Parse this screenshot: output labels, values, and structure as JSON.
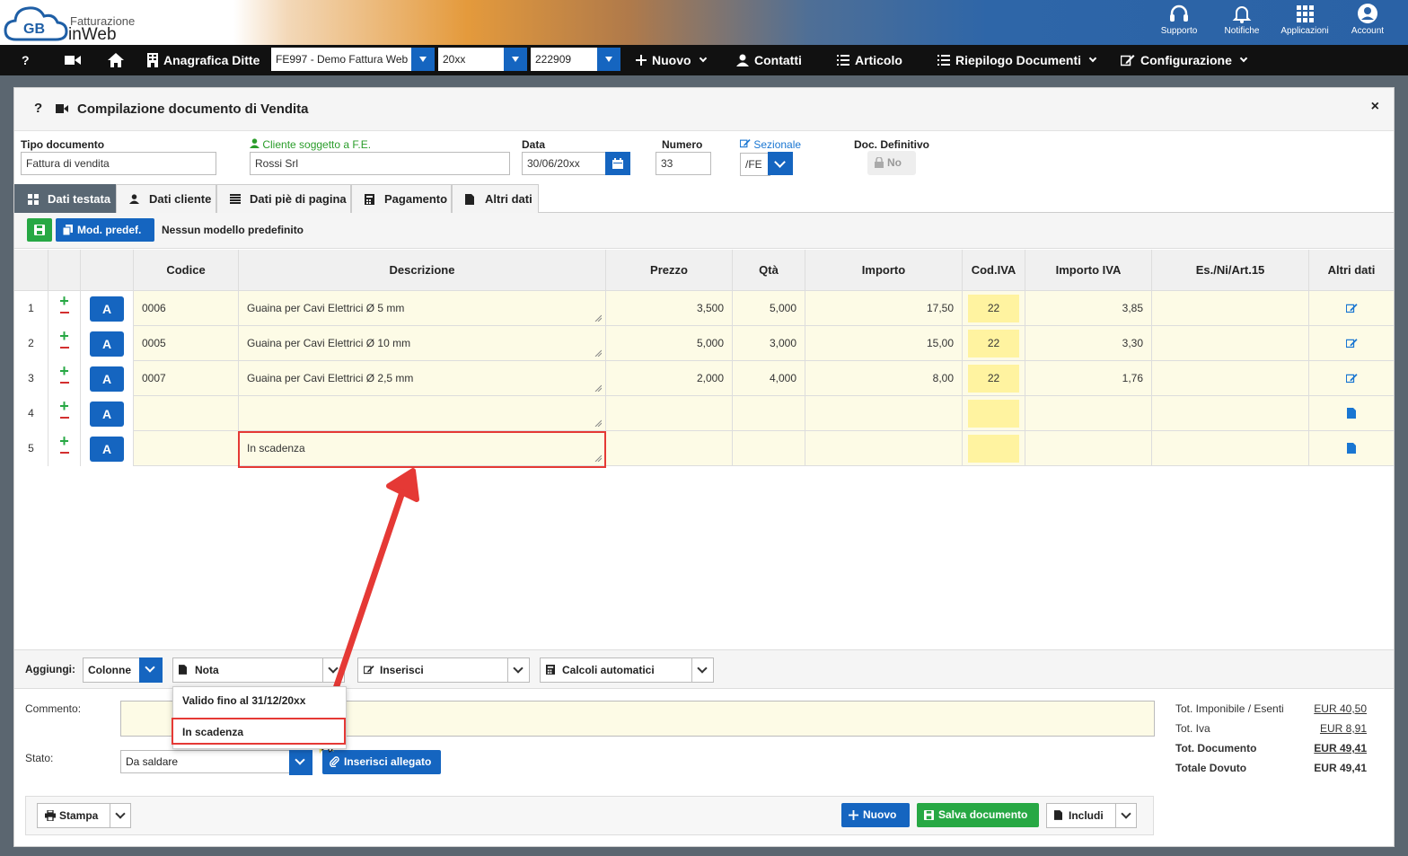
{
  "brand": {
    "line1": "Fatturazione",
    "line2": "inWeb",
    "logo_text": "GB"
  },
  "topicons": [
    {
      "label": "Supporto",
      "icon": "headset-icon"
    },
    {
      "label": "Notifiche",
      "icon": "bell-icon"
    },
    {
      "label": "Applicazioni",
      "icon": "grid-icon"
    },
    {
      "label": "Account",
      "icon": "user-circle-icon"
    }
  ],
  "nav": {
    "help": "?",
    "anagrafica": "Anagrafica Ditte",
    "company_select": "FE997 - Demo Fattura Web",
    "year_select": "20xx",
    "code_select": "222909",
    "nuovo": "Nuovo",
    "contatti": "Contatti",
    "articolo": "Articolo",
    "riepilogo": "Riepilogo Documenti",
    "configurazione": "Configurazione"
  },
  "panel": {
    "help": "?",
    "title": "Compilazione documento di Vendita",
    "close": "×"
  },
  "form": {
    "tipo_label": "Tipo documento",
    "tipo_value": "Fattura di vendita",
    "cliente_label": "Cliente soggetto a F.E.",
    "cliente_value": "Rossi Srl",
    "data_label": "Data",
    "data_value": "30/06/20xx",
    "numero_label": "Numero",
    "numero_value": "33",
    "sezionale_label": "Sezionale",
    "sezionale_value": "/FE",
    "definitivo_label": "Doc. Definitivo",
    "definitivo_value": "No"
  },
  "tabs": [
    "Dati testata",
    "Dati cliente",
    "Dati piè di pagina",
    "Pagamento",
    "Altri dati"
  ],
  "model": {
    "button": "Mod. predef.",
    "text": "Nessun modello predefinito"
  },
  "grid": {
    "headers": [
      "Codice",
      "Descrizione",
      "Prezzo",
      "Qtà",
      "Importo",
      "Cod.IVA",
      "Importo IVA",
      "Es./Ni/Art.15",
      "Altri dati"
    ],
    "rows": [
      {
        "n": "1",
        "codice": "0006",
        "descrizione": "Guaina per Cavi Elettrici Ø 5 mm",
        "prezzo": "3,500",
        "qta": "5,000",
        "importo": "17,50",
        "iva": "22",
        "importo_iva": "3,85",
        "es": ""
      },
      {
        "n": "2",
        "codice": "0005",
        "descrizione": "Guaina per Cavi Elettrici Ø 10 mm",
        "prezzo": "5,000",
        "qta": "3,000",
        "importo": "15,00",
        "iva": "22",
        "importo_iva": "3,30",
        "es": ""
      },
      {
        "n": "3",
        "codice": "0007",
        "descrizione": "Guaina per Cavi Elettrici Ø 2,5 mm",
        "prezzo": "2,000",
        "qta": "4,000",
        "importo": "8,00",
        "iva": "22",
        "importo_iva": "1,76",
        "es": ""
      },
      {
        "n": "4",
        "codice": "",
        "descrizione": "",
        "prezzo": "",
        "qta": "",
        "importo": "",
        "iva": "",
        "importo_iva": "",
        "es": ""
      },
      {
        "n": "5",
        "codice": "",
        "descrizione": "In scadenza",
        "prezzo": "",
        "qta": "",
        "importo": "",
        "iva": "",
        "importo_iva": "",
        "es": ""
      }
    ],
    "row_button": "A"
  },
  "aggiungi": {
    "label": "Aggiungi:",
    "colonne": "Colonne",
    "nota": "Nota",
    "inserisci": "Inserisci",
    "calcoli": "Calcoli automatici",
    "menu_items": [
      "Valido fino al 31/12/20xx",
      "In scadenza"
    ]
  },
  "bottom": {
    "commento_label": "Commento:",
    "stato_label": "Stato:",
    "stato_value": "Da saldare",
    "allegato": "Inserisci allegato"
  },
  "totals": [
    {
      "label": "Tot. Imponibile / Esenti",
      "value": "EUR 40,50"
    },
    {
      "label": "Tot. Iva",
      "value": "EUR 8,91"
    },
    {
      "label": "Tot. Documento",
      "value": "EUR 49,41"
    },
    {
      "label": "Totale Dovuto",
      "value": "EUR 49,41"
    }
  ],
  "footer": {
    "stampa": "Stampa",
    "nuovo": "Nuovo",
    "salva": "Salva documento",
    "includi": "Includi"
  },
  "colors": {
    "accent": "#1565c0",
    "success": "#27a844",
    "highlight": "#e53935",
    "row_bg": "#fdfbe6",
    "iva_bg": "#fff3a0"
  }
}
